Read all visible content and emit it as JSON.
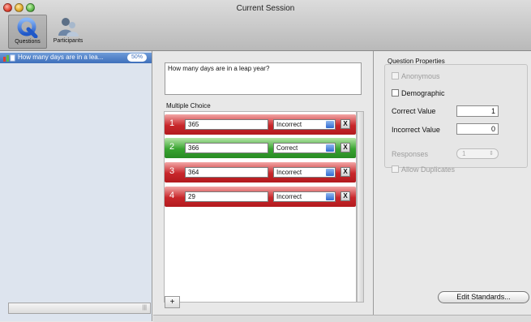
{
  "window": {
    "title": "Current Session"
  },
  "toolbar": {
    "questions_label": "Questions",
    "participants_label": "Participants"
  },
  "sidebar": {
    "items": [
      {
        "label": "How many days are in a lea...",
        "percent": "50%"
      }
    ]
  },
  "question": {
    "text": "How many days are in a leap year?"
  },
  "multiple_choice": {
    "title": "Multiple Choice",
    "add_label": "+",
    "answers": [
      {
        "number": "1",
        "value": "365",
        "status": "Incorrect",
        "color": "#c8272b"
      },
      {
        "number": "2",
        "value": "366",
        "status": "Correct",
        "color": "#39a431"
      },
      {
        "number": "3",
        "value": "364",
        "status": "Incorrect",
        "color": "#c8272b"
      },
      {
        "number": "4",
        "value": "29",
        "status": "Incorrect",
        "color": "#c8272b"
      }
    ],
    "delete_label": "X"
  },
  "properties": {
    "title": "Question Properties",
    "anonymous_label": "Anonymous",
    "demographic_label": "Demographic",
    "correct_value_label": "Correct Value",
    "correct_value": "1",
    "incorrect_value_label": "Incorrect Value",
    "incorrect_value": "0",
    "responses_label": "Responses",
    "responses_value": "1",
    "allow_duplicates_label": "Allow Duplicates",
    "edit_standards_label": "Edit Standards..."
  }
}
